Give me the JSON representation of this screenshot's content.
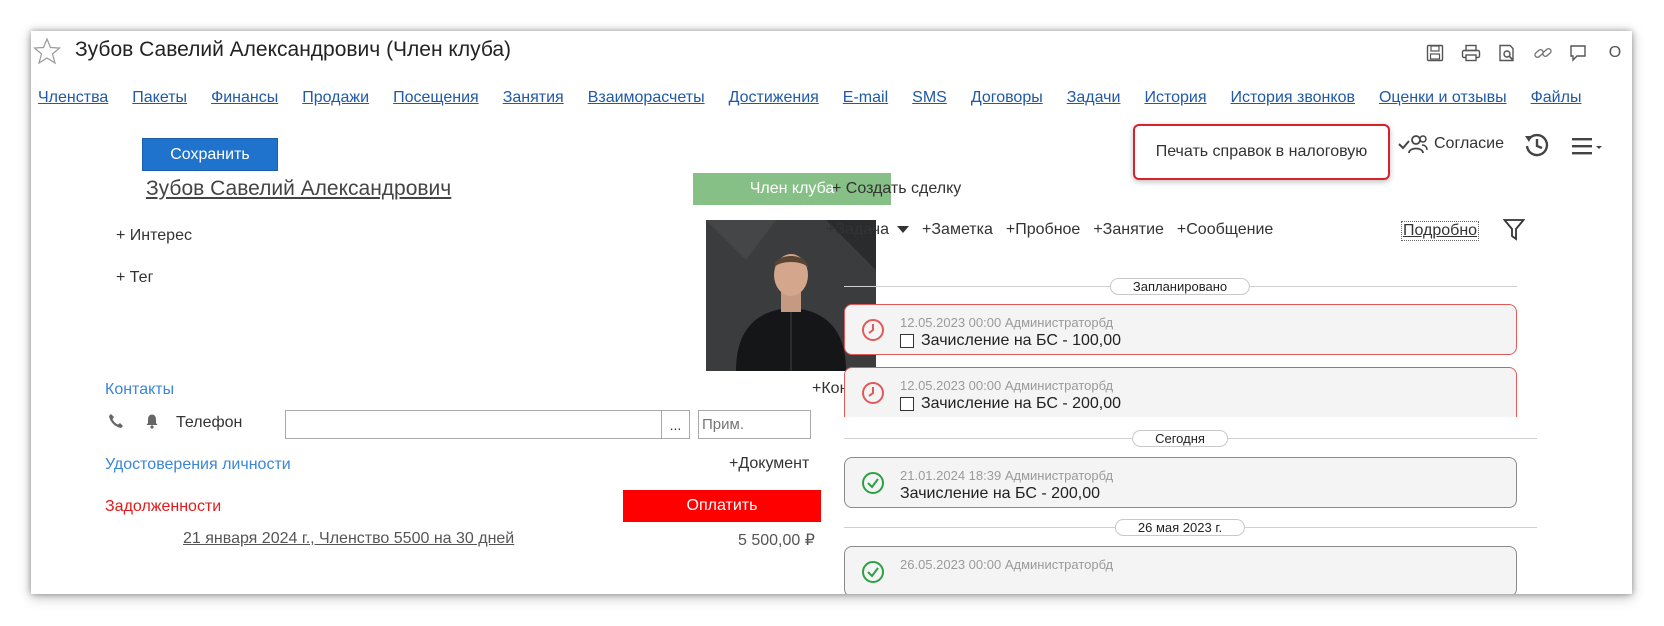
{
  "window": {
    "title": "Зубов Савелий Александрович (Член клуба)",
    "tools": [
      "save-icon",
      "print-icon",
      "preview-icon",
      "link-icon",
      "chat-icon"
    ],
    "tools_tail": "О"
  },
  "tabs": [
    "Членства",
    "Пакеты",
    "Финансы",
    "Продажи",
    "Посещения",
    "Занятия",
    "Взаиморасчеты",
    "Достижения",
    "E-mail",
    "SMS",
    "Договоры",
    "Задачи",
    "История",
    "История звонков",
    "Оценки и отзывы",
    "Файлы"
  ],
  "toolbar": {
    "save_label": "Сохранить",
    "print_label": "Печать справок в налоговую",
    "consent_label": "Согласие"
  },
  "client": {
    "name": "Зубов Савелий Александрович",
    "status": "Член клуба",
    "interest_link": "+ Интерес",
    "tag_link": "+ Тег"
  },
  "contacts": {
    "title": "Контакты",
    "add_label": "+Контакт",
    "phone_label": "Телефон",
    "phone_value": "",
    "dots": "...",
    "note_placeholder": "Прим."
  },
  "documents": {
    "title": "Удостоверения личности",
    "add_label": "+Документ"
  },
  "debts": {
    "title": "Задолженности",
    "pay_label": "Оплатить",
    "items": [
      {
        "text": "21 января 2024 г., Членство 5500 на 30 дней",
        "amount": "5 500,00 ₽"
      }
    ]
  },
  "timeline": {
    "create_deal": "+ Создать сделку",
    "actions": [
      "+Задача",
      "+Заметка",
      "+Пробное",
      "+Занятие",
      "+Сообщение"
    ],
    "details_label": "Подробно",
    "groups": {
      "planned": "Запланировано",
      "today": "Сегодня",
      "date": "26 мая 2023 г."
    },
    "events": [
      {
        "meta": "12.05.2023 00:00 Администраторбд",
        "title": "Зачисление на БС - 100,00",
        "status": "overdue"
      },
      {
        "meta": "12.05.2023 00:00 Администраторбд",
        "title": "Зачисление на БС - 200,00",
        "status": "overdue"
      },
      {
        "meta": "21.01.2024 18:39 Администраторбд",
        "title": "Зачисление на БС - 200,00",
        "status": "done"
      },
      {
        "meta": "26.05.2023 00:00 Администраторбд",
        "title": "",
        "status": "done"
      }
    ]
  },
  "colors": {
    "link": "#1f59a8",
    "primary_button": "#1f73cc",
    "member_badge": "#86c086",
    "pay_button": "#ff0000",
    "highlight_border": "#d9212b",
    "overdue": "#e15a5a",
    "done_icon": "#2ea043",
    "section_blue": "#3a86d8"
  }
}
